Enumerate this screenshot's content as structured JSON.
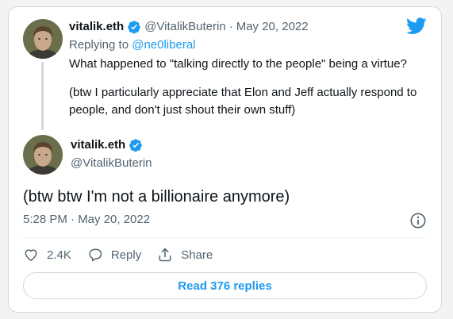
{
  "reply_tweet": {
    "author_name": "vitalik.eth",
    "author_handle": "@VitalikButerin",
    "date": "May 20, 2022",
    "separator": "·",
    "replying_to_prefix": "Replying to",
    "replying_to_handle": "@ne0liberal",
    "paragraphs": [
      "What happened to \"talking directly to the people\" being a virtue?",
      "(btw I particularly appreciate that Elon and Jeff actually respond to people, and don't just shout their own stuff)"
    ]
  },
  "main_tweet": {
    "author_name": "vitalik.eth",
    "author_handle": "@VitalikButerin",
    "text": "(btw btw I'm not a billionaire anymore)",
    "timestamp": "5:28 PM · May 20, 2022"
  },
  "actions": {
    "like_count": "2.4K",
    "reply_label": "Reply",
    "share_label": "Share"
  },
  "read_replies_label": "Read 376 replies",
  "colors": {
    "accent": "#1d9bf0",
    "text": "#0f1419",
    "muted": "#536471",
    "border": "#cfd9de"
  },
  "icons": [
    "twitter-logo-icon",
    "verified-badge-icon",
    "info-icon",
    "heart-icon",
    "reply-icon",
    "share-icon"
  ]
}
